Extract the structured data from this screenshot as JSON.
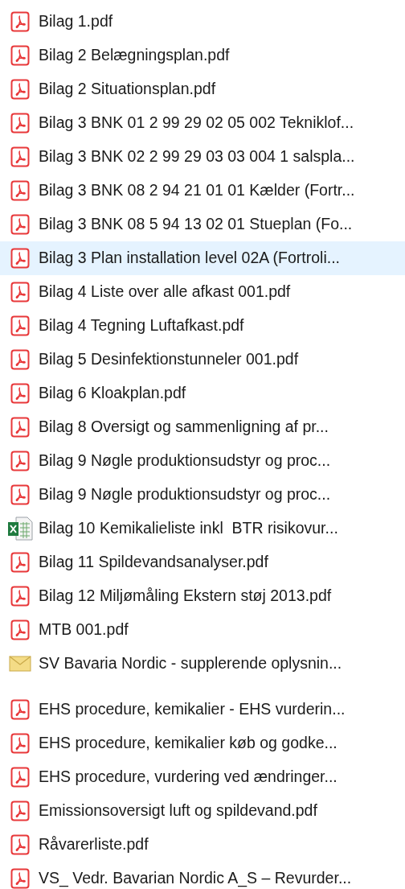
{
  "groups": [
    {
      "files": [
        {
          "name": "Bilag 1.pdf",
          "kind": "pdf",
          "selected": false
        },
        {
          "name": "Bilag 2 Belægningsplan.pdf",
          "kind": "pdf",
          "selected": false
        },
        {
          "name": "Bilag 2 Situationsplan.pdf",
          "kind": "pdf",
          "selected": false
        },
        {
          "name": "Bilag 3 BNK 01 2 99 29 02 05 002 Tekniklof...",
          "kind": "pdf",
          "selected": false
        },
        {
          "name": "Bilag 3 BNK 02 2 99 29 03 03 004 1 salspla...",
          "kind": "pdf",
          "selected": false
        },
        {
          "name": "Bilag 3 BNK 08 2 94 21 01 01 Kælder (Fortr...",
          "kind": "pdf",
          "selected": false
        },
        {
          "name": "Bilag 3 BNK 08 5 94 13 02 01 Stueplan (Fo...",
          "kind": "pdf",
          "selected": false
        },
        {
          "name": "Bilag 3 Plan installation level 02A (Fortroli...",
          "kind": "pdf",
          "selected": true
        },
        {
          "name": "Bilag 4 Liste over alle afkast 001.pdf",
          "kind": "pdf",
          "selected": false
        },
        {
          "name": "Bilag 4 Tegning Luftafkast.pdf",
          "kind": "pdf",
          "selected": false
        },
        {
          "name": "Bilag 5 Desinfektionstunneler 001.pdf",
          "kind": "pdf",
          "selected": false
        },
        {
          "name": "Bilag 6 Kloakplan.pdf",
          "kind": "pdf",
          "selected": false
        },
        {
          "name": "Bilag 8 Oversigt og sammenligning af pr...",
          "kind": "pdf",
          "selected": false
        },
        {
          "name": "Bilag 9 Nøgle produktionsudstyr og proc...",
          "kind": "pdf",
          "selected": false
        },
        {
          "name": "Bilag 9 Nøgle produktionsudstyr og proc...",
          "kind": "pdf",
          "selected": false
        },
        {
          "name": "Bilag 10 Kemikalieliste inkl  BTR risikovur...",
          "kind": "excel",
          "selected": false
        },
        {
          "name": "Bilag 11 Spildevandsanalyser.pdf",
          "kind": "pdf",
          "selected": false
        },
        {
          "name": "Bilag 12 Miljømåling Ekstern støj 2013.pdf",
          "kind": "pdf",
          "selected": false
        },
        {
          "name": "MTB 001.pdf",
          "kind": "pdf",
          "selected": false
        },
        {
          "name": "SV Bavaria Nordic - supplerende oplysnin...",
          "kind": "mail",
          "selected": false
        }
      ]
    },
    {
      "files": [
        {
          "name": "EHS procedure, kemikalier - EHS vurderin...",
          "kind": "pdf",
          "selected": false
        },
        {
          "name": "EHS procedure, kemikalier køb og godke...",
          "kind": "pdf",
          "selected": false
        },
        {
          "name": "EHS procedure, vurdering ved ændringer...",
          "kind": "pdf",
          "selected": false
        },
        {
          "name": "Emissionsoversigt luft og spildevand.pdf",
          "kind": "pdf",
          "selected": false
        },
        {
          "name": "Råvarerliste.pdf",
          "kind": "pdf",
          "selected": false
        },
        {
          "name": "VS_ Vedr. Bavarian Nordic A_S – Revurder...",
          "kind": "pdf",
          "selected": false
        }
      ]
    }
  ]
}
